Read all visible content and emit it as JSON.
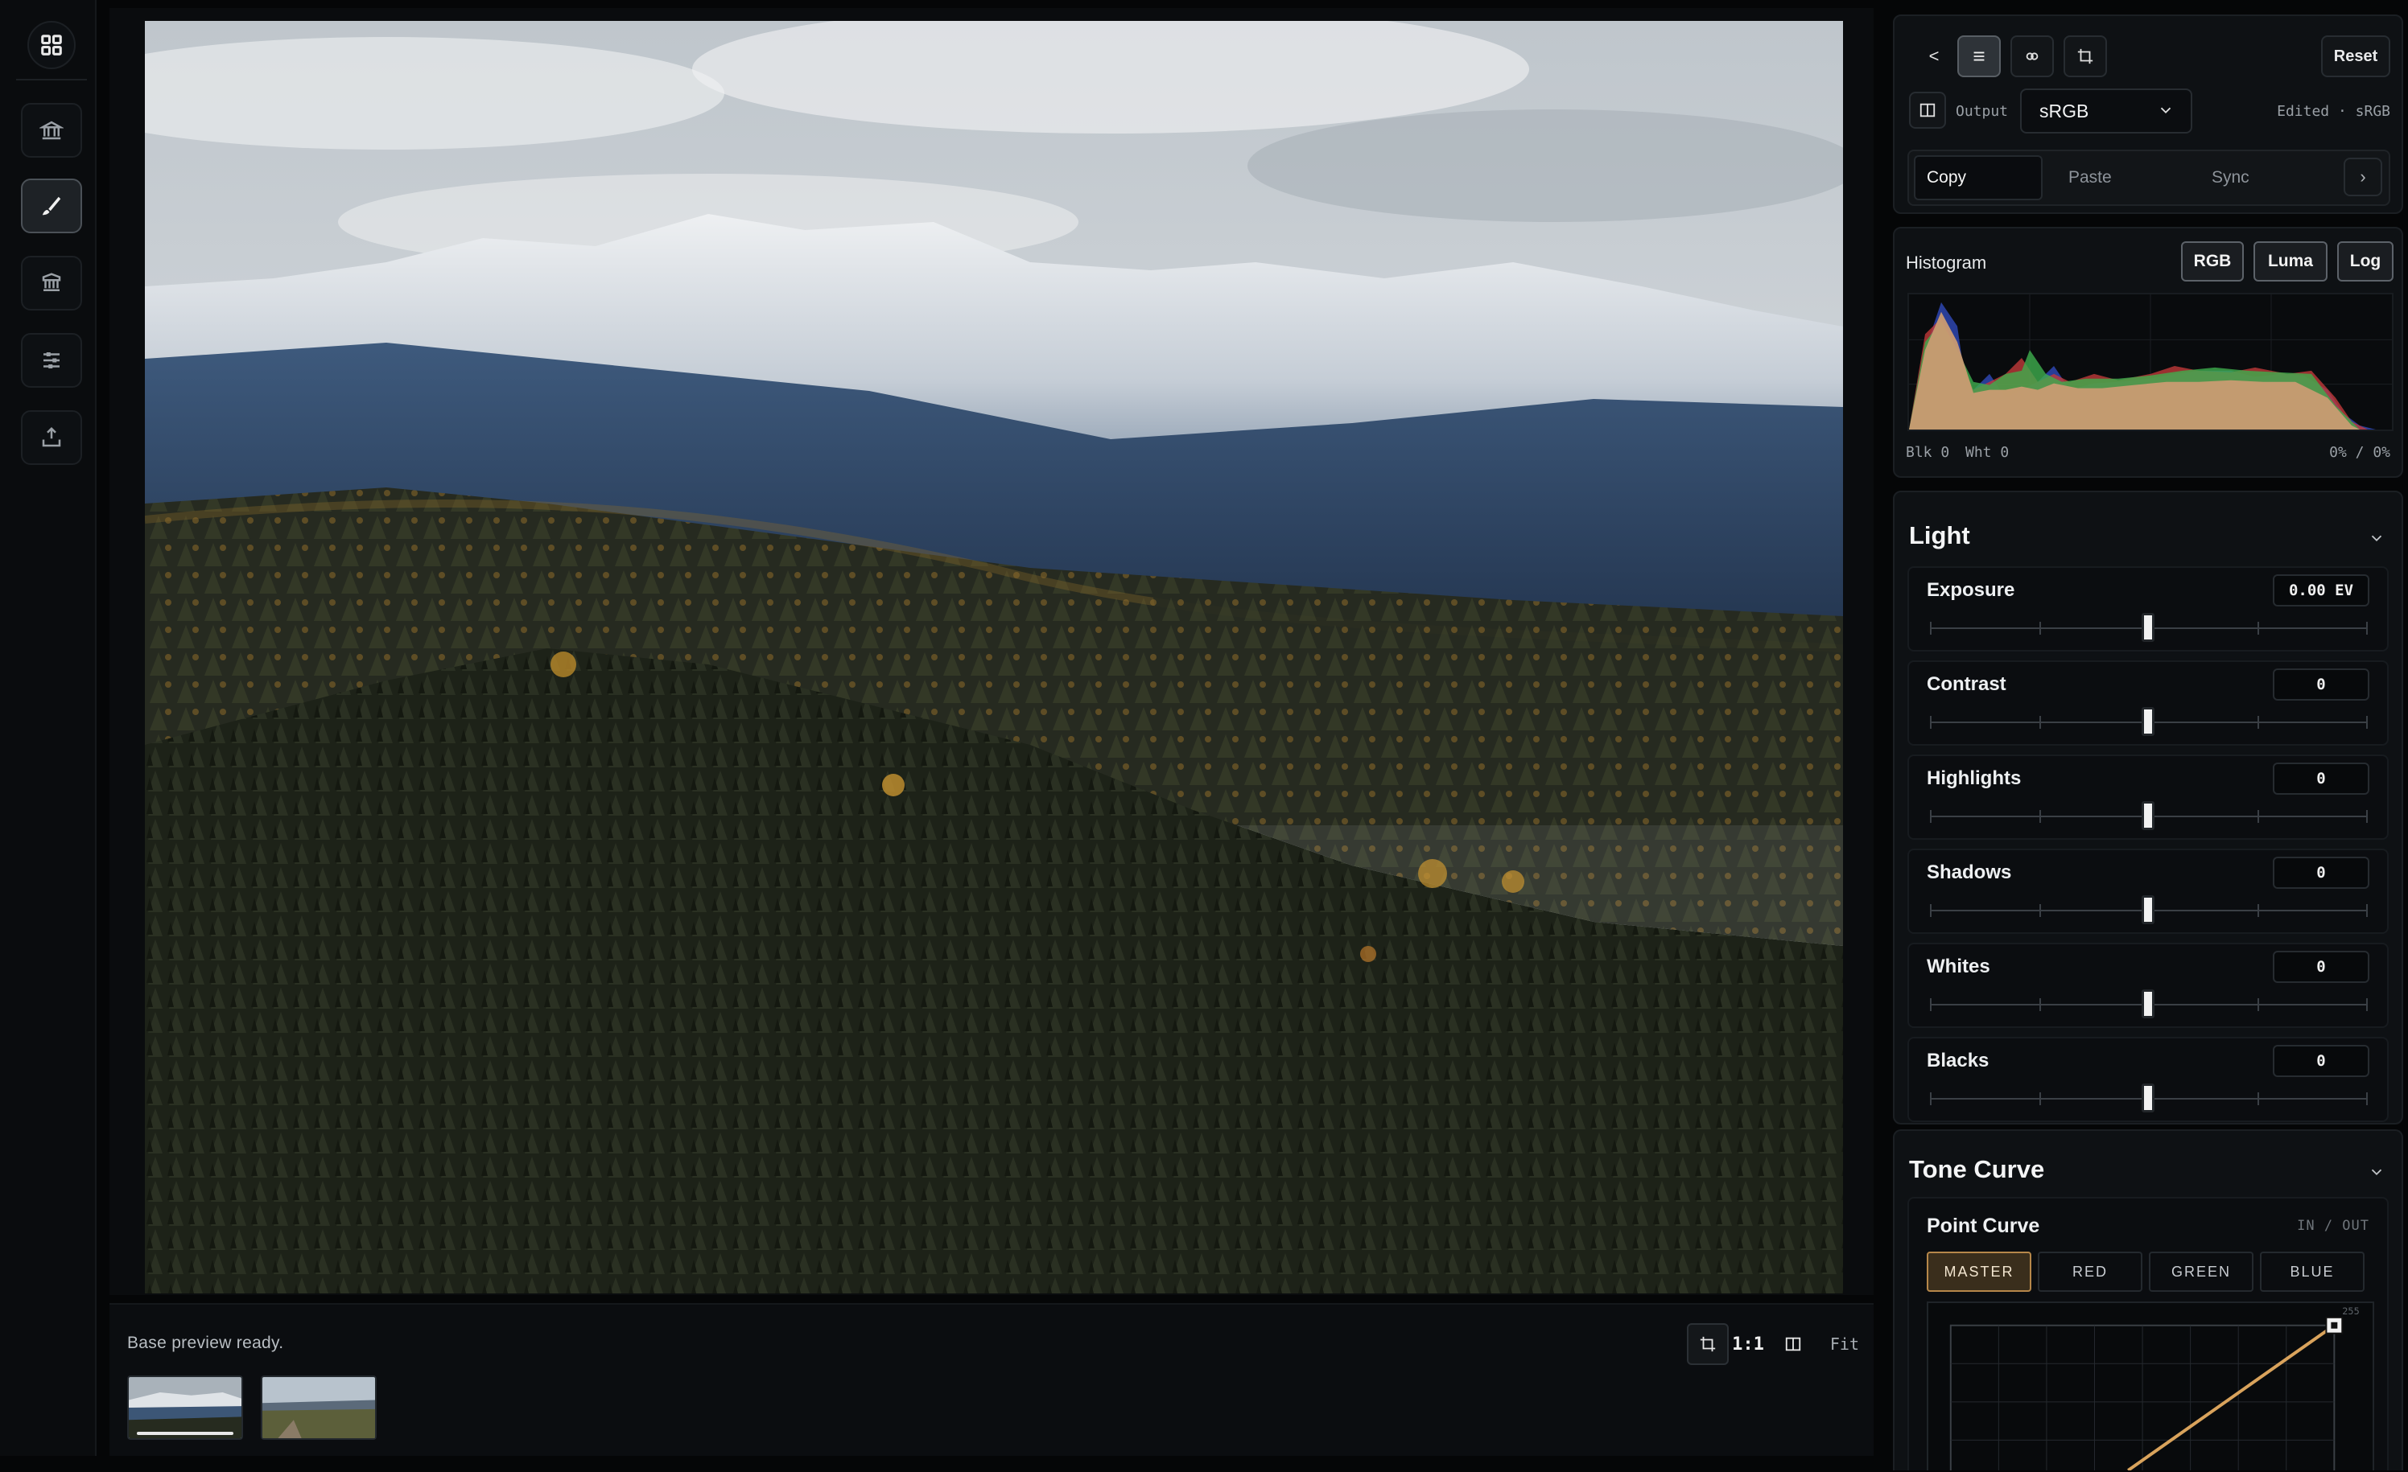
{
  "rail": {
    "items": [
      {
        "name": "library-grid-icon"
      },
      {
        "name": "collections-icon"
      },
      {
        "name": "edit-brush-icon"
      },
      {
        "name": "presets-icon"
      },
      {
        "name": "adjust-sliders-icon"
      },
      {
        "name": "export-icon"
      }
    ]
  },
  "viewer": {
    "status": "Base preview ready.",
    "zoom_label": "1:1",
    "fit_label": "Fit"
  },
  "panel": {
    "header": {
      "back": "<",
      "reset": "Reset",
      "output_label": "Output",
      "output_value": "sRGB",
      "status": "Edited · sRGB",
      "copy": "Copy",
      "paste": "Paste",
      "sync": "Sync",
      "more": "›"
    },
    "histogram": {
      "title": "Histogram",
      "modes": [
        "RGB",
        "Luma",
        "Log"
      ],
      "blk": "Blk 0",
      "wht": "Wht 0",
      "clip": "0% / 0%"
    },
    "light": {
      "title": "Light",
      "sliders": [
        {
          "name": "Exposure",
          "value": "0.00 EV",
          "position": 0.5
        },
        {
          "name": "Contrast",
          "value": "0",
          "position": 0.5
        },
        {
          "name": "Highlights",
          "value": "0",
          "position": 0.5
        },
        {
          "name": "Shadows",
          "value": "0",
          "position": 0.5
        },
        {
          "name": "Whites",
          "value": "0",
          "position": 0.5
        },
        {
          "name": "Blacks",
          "value": "0",
          "position": 0.5
        }
      ]
    },
    "tone_curve": {
      "title": "Tone Curve",
      "point_curve": "Point Curve",
      "in_out": "IN / OUT",
      "channels": [
        "MASTER",
        "RED",
        "GREEN",
        "BLUE"
      ],
      "max_label": "255"
    }
  },
  "colors": {
    "accent": "#b6874a",
    "curve": "#d9a35c"
  }
}
